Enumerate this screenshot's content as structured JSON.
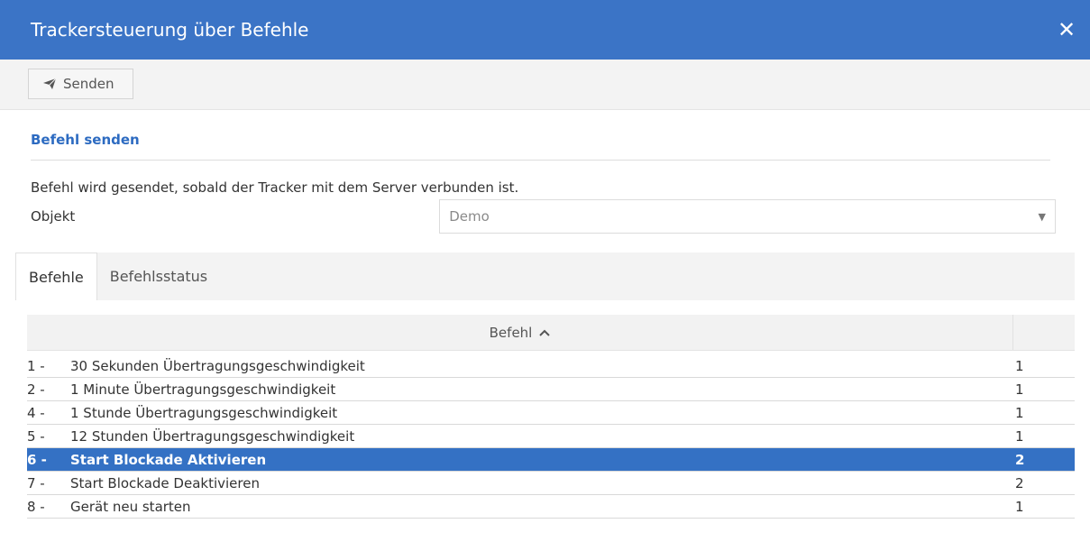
{
  "window": {
    "title": "Trackersteuerung über Befehle",
    "close_label": "✕"
  },
  "toolbar": {
    "send_label": "Senden"
  },
  "section": {
    "title": "Befehl senden",
    "info": "Befehl wird gesendet, sobald der Tracker mit dem Server verbunden ist.",
    "object_label": "Objekt",
    "object_value": "Demo"
  },
  "tabs": [
    {
      "label": "Befehle",
      "active": true
    },
    {
      "label": "Befehlsstatus",
      "active": false
    }
  ],
  "table": {
    "header": "Befehl",
    "rows": [
      {
        "num": "1 -",
        "name": "30 Sekunden Übertragungsgeschwindigkeit",
        "count": "1",
        "selected": false
      },
      {
        "num": "2 -",
        "name": "1 Minute Übertragungsgeschwindigkeit",
        "count": "1",
        "selected": false
      },
      {
        "num": "4 -",
        "name": "1 Stunde Übertragungsgeschwindigkeit",
        "count": "1",
        "selected": false
      },
      {
        "num": "5 -",
        "name": "12 Stunden Übertragungsgeschwindigkeit",
        "count": "1",
        "selected": false
      },
      {
        "num": "6 -",
        "name": "Start Blockade Aktivieren",
        "count": "2",
        "selected": true
      },
      {
        "num": "7 -",
        "name": "Start Blockade Deaktivieren",
        "count": "2",
        "selected": false
      },
      {
        "num": "8 -",
        "name": "Gerät neu starten",
        "count": "1",
        "selected": false
      }
    ]
  },
  "colors": {
    "header_blue": "#3b74c6",
    "selected_row": "#3471c4",
    "section_title": "#2d6bc1"
  },
  "icons": {
    "send": "paper-plane-icon",
    "close": "close-icon",
    "sort": "chevron-up-icon",
    "dropdown": "caret-down-icon"
  }
}
